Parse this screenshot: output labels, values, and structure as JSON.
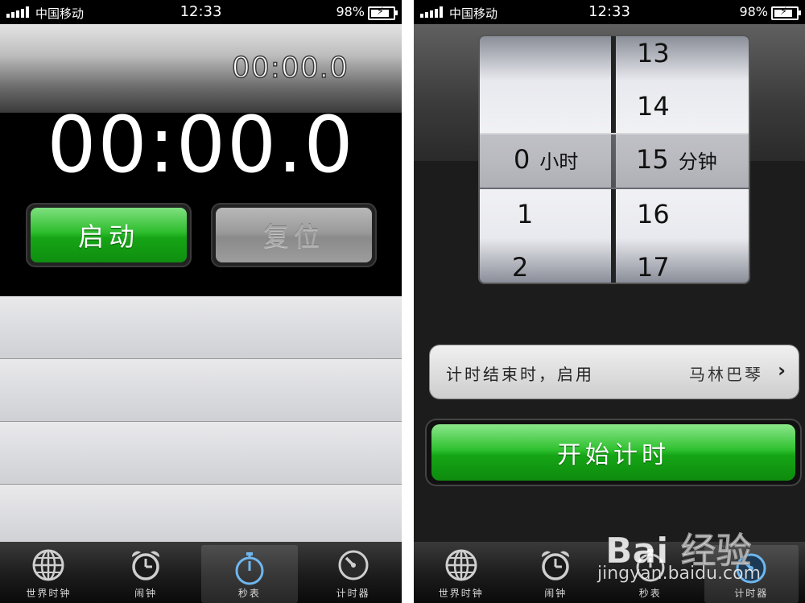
{
  "status_bar": {
    "carrier": "中国移动",
    "time": "12:33",
    "battery_percent": "98%",
    "battery_level": 0.98
  },
  "stopwatch": {
    "lap_time": "00:00.0",
    "main_time": "00:00.0",
    "start_label": "启动",
    "reset_label": "复位",
    "lap_rows": 4
  },
  "tabs": [
    {
      "label": "世界时钟",
      "icon": "globe-icon"
    },
    {
      "label": "闹钟",
      "icon": "alarm-clock-icon"
    },
    {
      "label": "秒表",
      "icon": "stopwatch-icon"
    },
    {
      "label": "计时器",
      "icon": "timer-icon"
    }
  ],
  "timer": {
    "hours_wheel": {
      "above": [
        "",
        ""
      ],
      "selected": "0",
      "below": [
        "1",
        "2"
      ],
      "unit": "小时"
    },
    "minutes_wheel": {
      "above": [
        "13",
        "14"
      ],
      "selected": "15",
      "below": [
        "16",
        "17"
      ],
      "unit": "分钟"
    },
    "when_done_label": "计时结束时，启用",
    "when_done_value": "马林巴琴",
    "start_label": "开始计时"
  },
  "watermark": {
    "brand": "Bai 经验",
    "url": "jingyan.baidu.com"
  }
}
